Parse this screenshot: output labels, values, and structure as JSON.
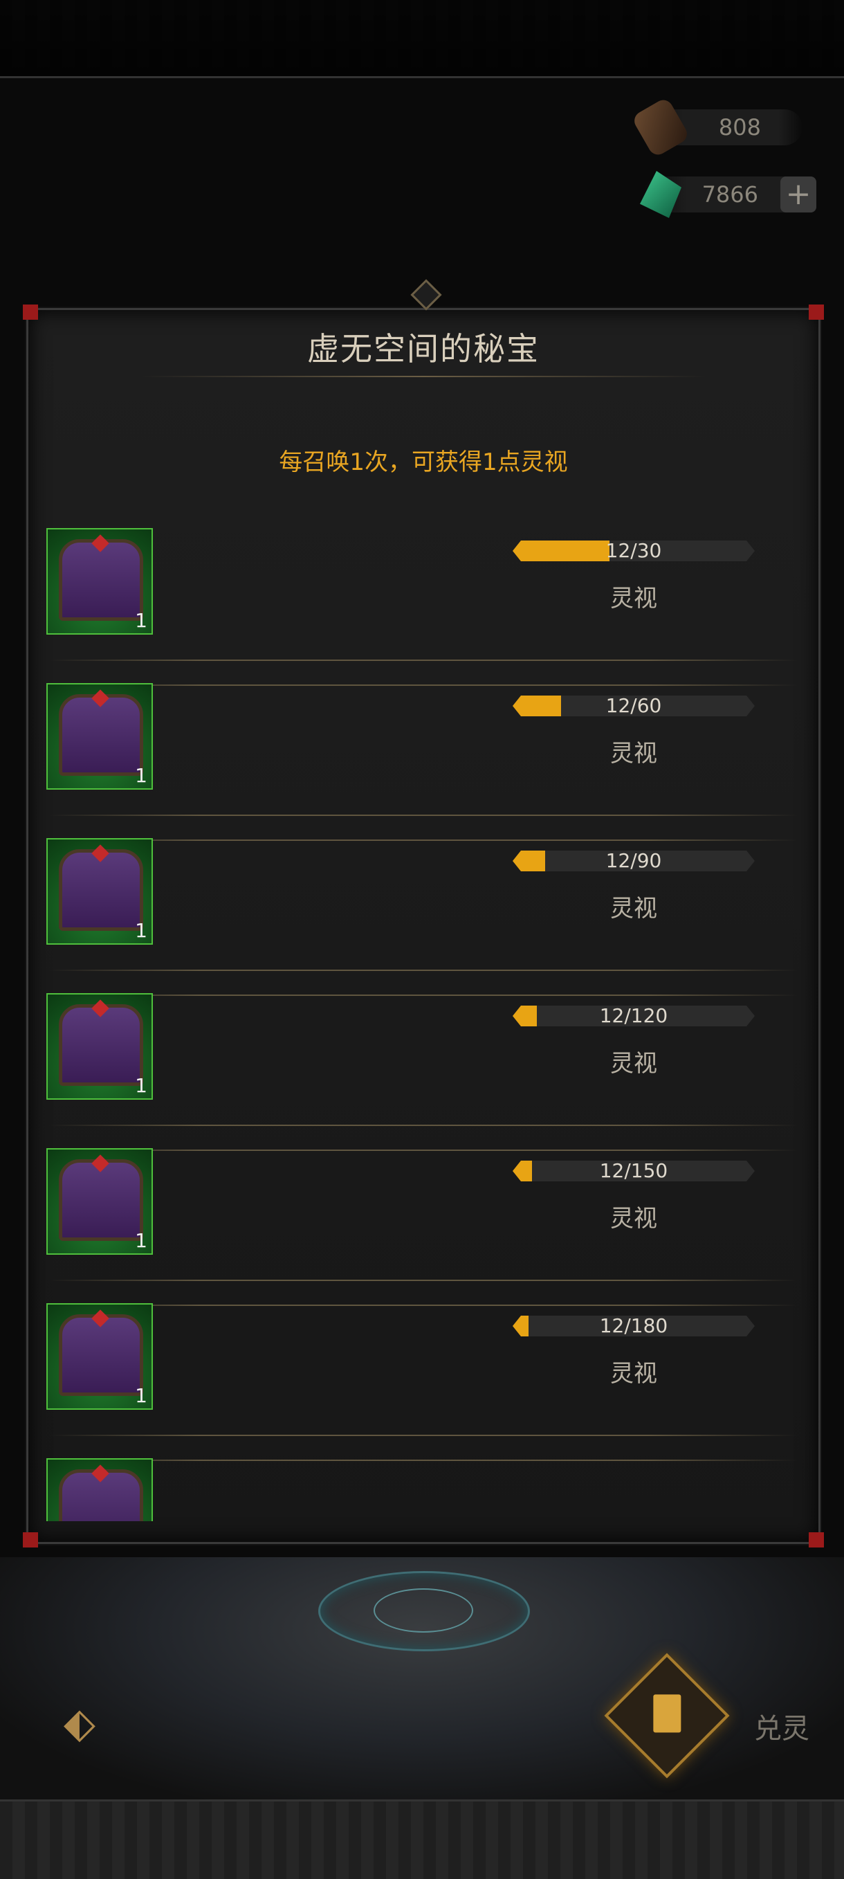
{
  "currencies": [
    {
      "icon": "scroll-icon",
      "value": "808"
    },
    {
      "icon": "jade-gem-icon",
      "value": "7866",
      "plus": "+"
    }
  ],
  "panel": {
    "title": "虚无空间的秘宝",
    "subtitle": "每召唤1次，可获得1点灵视"
  },
  "rewards": [
    {
      "item_count": "1",
      "progress_text": "12/30",
      "progress": 0.4,
      "label": "灵视"
    },
    {
      "item_count": "1",
      "progress_text": "12/60",
      "progress": 0.2,
      "label": "灵视"
    },
    {
      "item_count": "1",
      "progress_text": "12/90",
      "progress": 0.1333,
      "label": "灵视"
    },
    {
      "item_count": "1",
      "progress_text": "12/120",
      "progress": 0.1,
      "label": "灵视"
    },
    {
      "item_count": "1",
      "progress_text": "12/150",
      "progress": 0.08,
      "label": "灵视"
    },
    {
      "item_count": "1",
      "progress_text": "12/180",
      "progress": 0.0667,
      "label": "灵视"
    }
  ],
  "bottom": {
    "back_icon": "back-arrow-icon",
    "redeem_label": "兑灵"
  },
  "colors": {
    "accent": "#e8a414",
    "subtitle": "#e9a622",
    "item_border": "#4fbf3c"
  }
}
